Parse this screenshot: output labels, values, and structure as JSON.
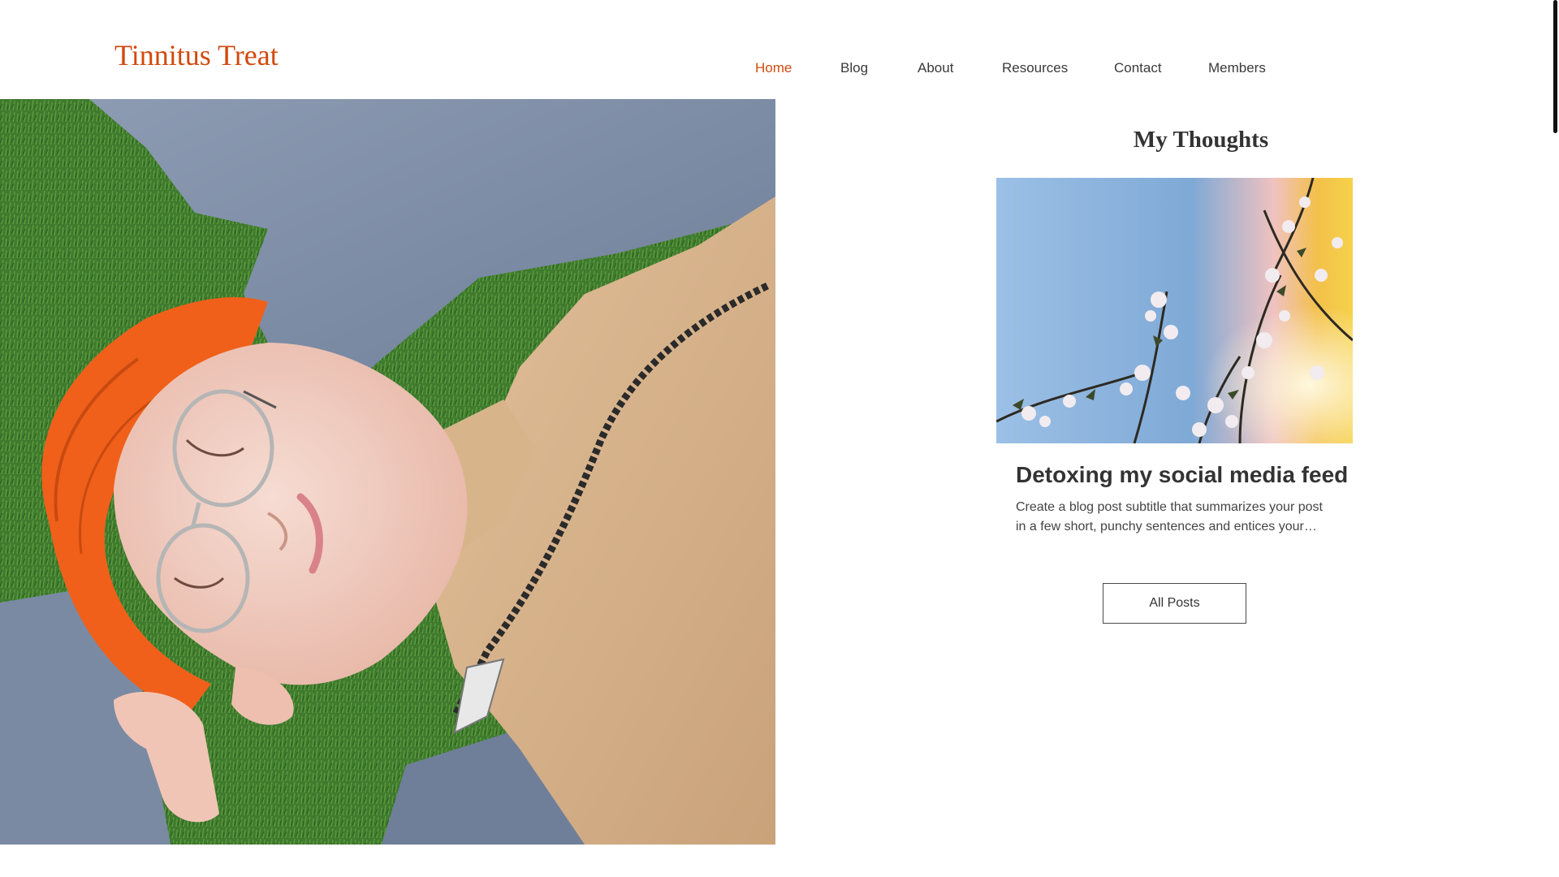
{
  "header": {
    "site_title": "Tinnitus Treat",
    "nav": [
      {
        "label": "Home",
        "active": true
      },
      {
        "label": "Blog",
        "active": false
      },
      {
        "label": "About",
        "active": false
      },
      {
        "label": "Resources",
        "active": false
      },
      {
        "label": "Contact",
        "active": false
      },
      {
        "label": "Members",
        "active": false
      }
    ]
  },
  "blog": {
    "heading": "My Thoughts",
    "post": {
      "title": "Detoxing my social media feed",
      "excerpt": "Create a blog post subtitle that summarizes your post in a few short, punchy sentences and entices your audience to continue reading."
    },
    "all_posts_label": "All Posts"
  },
  "colors": {
    "accent": "#d14a0e",
    "text": "#333333"
  }
}
